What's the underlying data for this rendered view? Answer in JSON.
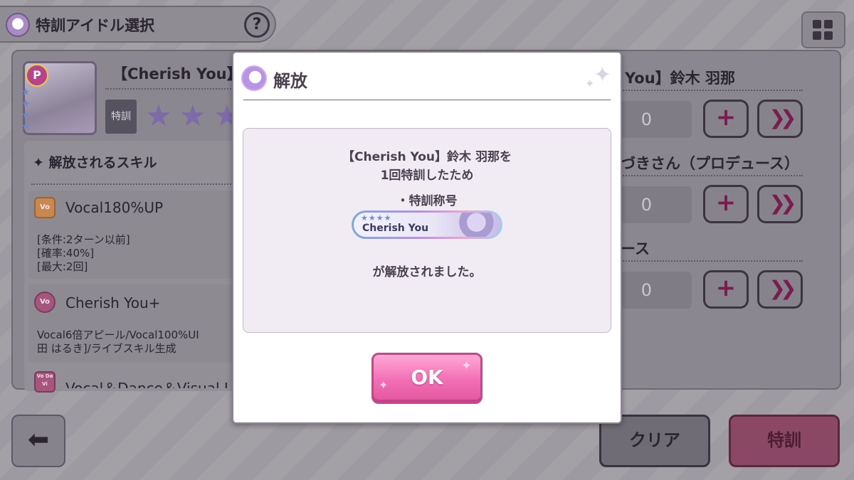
{
  "header": {
    "title": "特訓アイドル選択",
    "help_label": "?"
  },
  "card": {
    "badge": "P",
    "idol_name": "【Cherish You】",
    "tokkun_label": "特訓"
  },
  "skills": {
    "section_title": "✦ 解放されるスキル",
    "items": [
      {
        "icon": "Vo",
        "name": "Vocal180%UP",
        "desc": [
          "[条件:2ターン以前]",
          "[確率:40%]",
          "[最大:2回]"
        ]
      },
      {
        "icon": "Vo",
        "name": "Cherish You+",
        "desc": [
          "Vocal6倍アピール/Vocal100%UI",
          "田 はるき]/ライブスキル生成"
        ]
      },
      {
        "icon": "Vo Da Vi",
        "name": "Vocal＆Dance＆Visual I"
      }
    ]
  },
  "right_panel": {
    "rows": [
      {
        "title": "You】鈴木 羽那",
        "count": "0",
        "plus": "+",
        "max": "»"
      },
      {
        "title": "づきさん（プロデュース）",
        "count": "0",
        "plus": "+",
        "max": "»"
      },
      {
        "title": "ース",
        "count": "0",
        "plus": "+",
        "max": "»"
      }
    ]
  },
  "footer": {
    "back_label": "🡄",
    "clear_label": "クリア",
    "train_label": "特訓"
  },
  "modal": {
    "title": "解放",
    "line1": "【Cherish You】鈴木 羽那を",
    "line2": "1回特訓したため",
    "line3": "・特訓称号",
    "plate_text": "Cherish You",
    "plate_stars": "★★★★",
    "line4": "が解放されました。",
    "ok_label": "OK"
  },
  "colors": {
    "ok_pink": "#f26eb4",
    "modal_bg": "#ffffff",
    "message_box": "#f1ebf3",
    "text": "#4a4250"
  }
}
